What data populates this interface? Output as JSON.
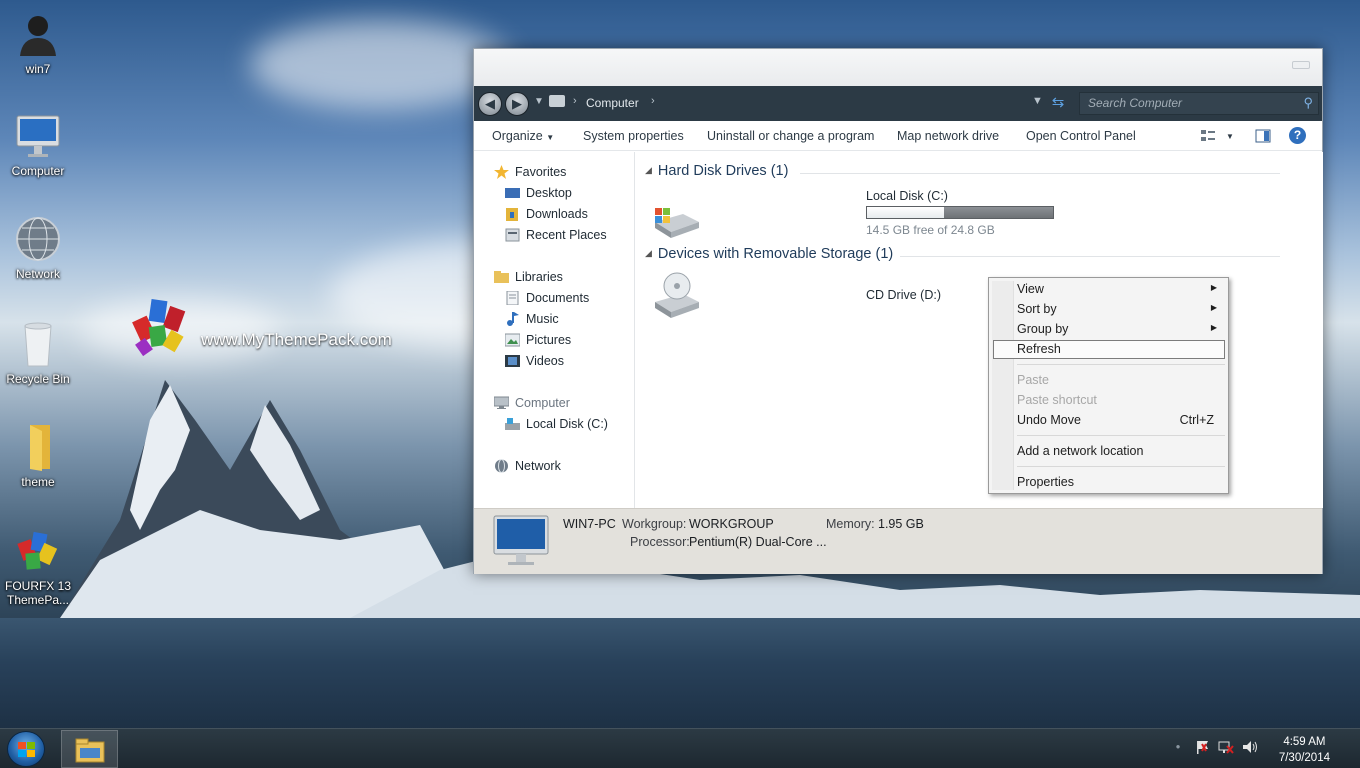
{
  "desktop": {
    "icons": [
      {
        "label": "win7",
        "icon": "user-icon"
      },
      {
        "label": "Computer",
        "icon": "imac-icon"
      },
      {
        "label": "Network",
        "icon": "globe-icon"
      },
      {
        "label": "Recycle Bin",
        "icon": "recycle-bin-icon"
      },
      {
        "label": "theme",
        "icon": "folder-icon"
      },
      {
        "label": "FOURFX 13",
        "label2": "ThemePa...",
        "icon": "themepack-icon"
      }
    ],
    "watermark": "www.MyThemePack.com"
  },
  "window": {
    "address": {
      "crumb": "Computer",
      "search_placeholder": "Search Computer"
    },
    "toolbar": {
      "organize": "Organize",
      "system_properties": "System properties",
      "uninstall": "Uninstall or change a program",
      "map_drive": "Map network drive",
      "control_panel": "Open Control Panel"
    },
    "nav": {
      "favorites": "Favorites",
      "desktop": "Desktop",
      "downloads": "Downloads",
      "recent": "Recent Places",
      "libraries": "Libraries",
      "documents": "Documents",
      "music": "Music",
      "pictures": "Pictures",
      "videos": "Videos",
      "computer": "Computer",
      "local_disk": "Local Disk (C:)",
      "network": "Network"
    },
    "content": {
      "hdd_header": "Hard Disk Drives (1)",
      "removable_header": "Devices with Removable Storage (1)",
      "local_disk_name": "Local Disk (C:)",
      "local_disk_free": "14.5 GB free of 24.8 GB",
      "local_disk_free_fraction": 0.415,
      "cd_name": "CD Drive (D:)"
    },
    "details": {
      "pc_name": "WIN7-PC",
      "workgroup_label": "Workgroup:",
      "workgroup": "WORKGROUP",
      "memory_label": "Memory:",
      "memory": "1.95 GB",
      "processor_label": "Processor:",
      "processor": "Pentium(R) Dual-Core  ..."
    }
  },
  "context_menu": {
    "view": "View",
    "sort_by": "Sort by",
    "group_by": "Group by",
    "refresh": "Refresh",
    "paste": "Paste",
    "paste_shortcut": "Paste shortcut",
    "undo_move": "Undo Move",
    "undo_shortcut": "Ctrl+Z",
    "add_network": "Add a network location",
    "properties": "Properties"
  },
  "taskbar": {
    "time": "4:59 AM",
    "date": "7/30/2014"
  },
  "colors": {
    "accent": "#2f6fbd",
    "address_bar": "#2c3a45",
    "details_pane": "#e3e1dc"
  }
}
